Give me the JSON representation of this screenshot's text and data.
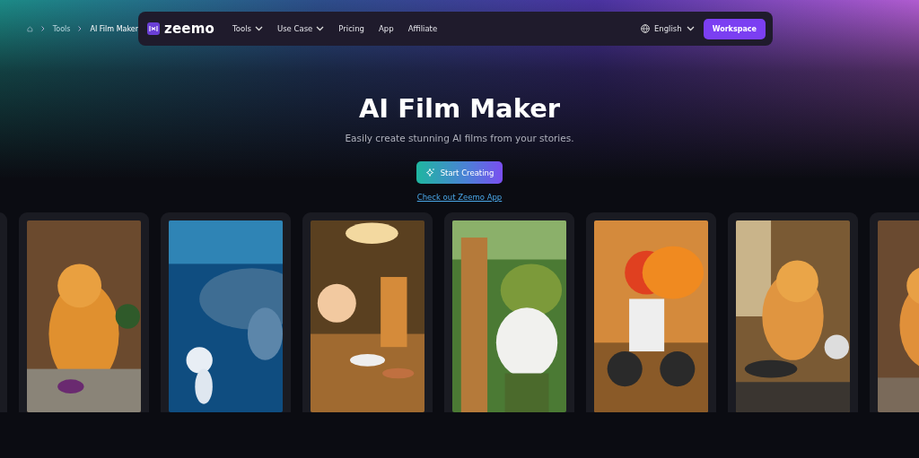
{
  "breadcrumb": [
    {
      "label": "Tools"
    },
    {
      "label": "AI Film Maker"
    }
  ],
  "navbar": {
    "logo": "zeemo",
    "links": [
      {
        "label": "Tools",
        "kind": "dropdown"
      },
      {
        "label": "Use Case",
        "kind": "dropdown"
      },
      {
        "label": "Pricing",
        "kind": "link"
      },
      {
        "label": "App",
        "kind": "link"
      },
      {
        "label": "Affiliate",
        "kind": "link"
      }
    ],
    "language": "English",
    "button": "Workspace"
  },
  "hero": {
    "title": "AI Film Maker",
    "subtitle": "Easily create stunning AI films from your stories.",
    "button": "Start Creating",
    "link": "Check out Zeemo App"
  },
  "gallery": [
    {
      "kind": "card"
    },
    {
      "kind": "picture"
    },
    {
      "kind": "picture"
    },
    {
      "kind": "picture"
    },
    {
      "kind": "picture"
    },
    {
      "kind": "picture"
    },
    {
      "kind": "picture"
    },
    {
      "kind": "picture"
    }
  ]
}
